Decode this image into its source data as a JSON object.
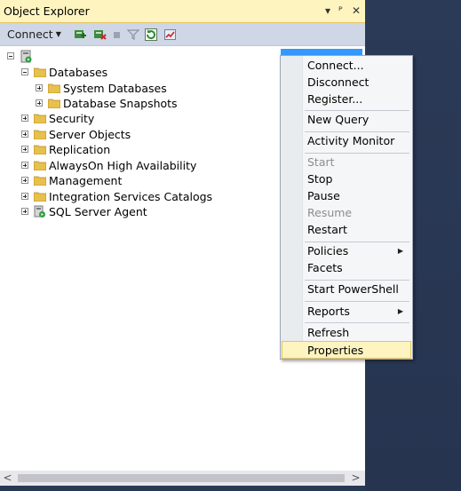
{
  "panel": {
    "title": "Object Explorer",
    "pin_glyph": "▾ ᵖ",
    "close_glyph": "✕"
  },
  "toolbar": {
    "connect_label": "Connect",
    "icons": [
      "connect-icon",
      "disconnect-icon",
      "stop-icon",
      "filter-icon",
      "refresh-icon",
      "activity-icon"
    ]
  },
  "tree": {
    "server_label": " ",
    "nodes": [
      {
        "label": "Databases"
      },
      {
        "label": "System Databases"
      },
      {
        "label": "Database Snapshots"
      },
      {
        "label": "Security"
      },
      {
        "label": "Server Objects"
      },
      {
        "label": "Replication"
      },
      {
        "label": "AlwaysOn High Availability"
      },
      {
        "label": "Management"
      },
      {
        "label": "Integration Services Catalogs"
      },
      {
        "label": "SQL Server Agent"
      }
    ]
  },
  "context_menu": {
    "items": [
      {
        "label": "Connect..."
      },
      {
        "label": "Disconnect"
      },
      {
        "label": "Register..."
      },
      {
        "label": "New Query"
      },
      {
        "label": "Activity Monitor"
      },
      {
        "label": "Start"
      },
      {
        "label": "Stop"
      },
      {
        "label": "Pause"
      },
      {
        "label": "Resume"
      },
      {
        "label": "Restart"
      },
      {
        "label": "Policies"
      },
      {
        "label": "Facets"
      },
      {
        "label": "Start PowerShell"
      },
      {
        "label": "Reports"
      },
      {
        "label": "Refresh"
      },
      {
        "label": "Properties"
      }
    ]
  },
  "colors": {
    "title_bar": "#fdf4bf",
    "toolbar": "#cfd6e5",
    "selection": "#3399ff",
    "menu_hover": "#fdf4bf",
    "background": "#293955"
  }
}
